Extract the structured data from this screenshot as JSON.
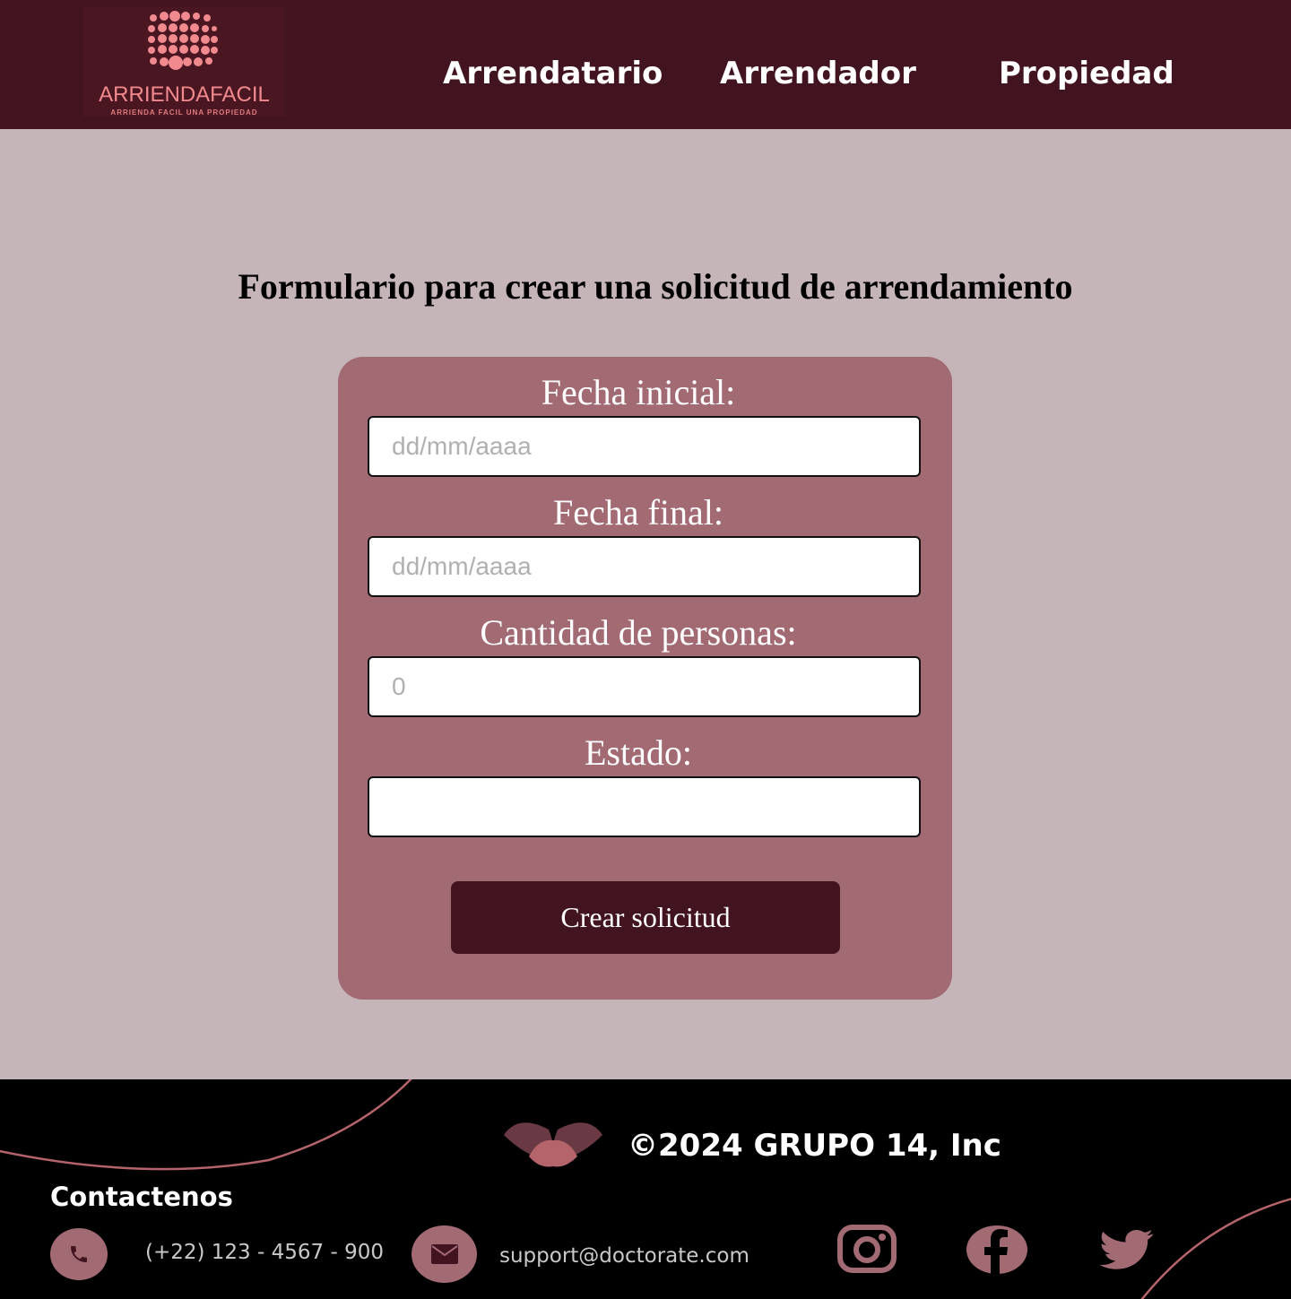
{
  "header": {
    "logo": {
      "name": "ARRIENDAFACIL",
      "tagline": "ARRIENDA FACIL UNA PROPIEDAD"
    },
    "nav": [
      {
        "label": "Arrendatario"
      },
      {
        "label": "Arrendador"
      },
      {
        "label": "Propiedad"
      }
    ]
  },
  "page": {
    "title": "Formulario para crear una solicitud de arrendamiento"
  },
  "form": {
    "fields": [
      {
        "label": "Fecha inicial:",
        "placeholder": "dd/mm/aaaa",
        "value": ""
      },
      {
        "label": "Fecha final:",
        "placeholder": "dd/mm/aaaa",
        "value": ""
      },
      {
        "label": "Cantidad de personas:",
        "placeholder": "0",
        "value": ""
      },
      {
        "label": "Estado:",
        "placeholder": "",
        "value": ""
      }
    ],
    "submit_label": "Crear solicitud"
  },
  "footer": {
    "copyright": "©2024 GRUPO 14, Inc",
    "contact_title": "Contactenos",
    "phone": "(+22) 123 - 4567 - 900",
    "email": "support@doctorate.com",
    "social": [
      {
        "icon": "instagram-icon"
      },
      {
        "icon": "facebook-icon"
      },
      {
        "icon": "twitter-icon"
      }
    ]
  },
  "colors": {
    "header_bg": "#42141f",
    "page_bg": "#c5b5b8",
    "card_bg": "#a26a73",
    "button_bg": "#42141f",
    "footer_bg": "#000000",
    "accent": "#a26a73"
  }
}
